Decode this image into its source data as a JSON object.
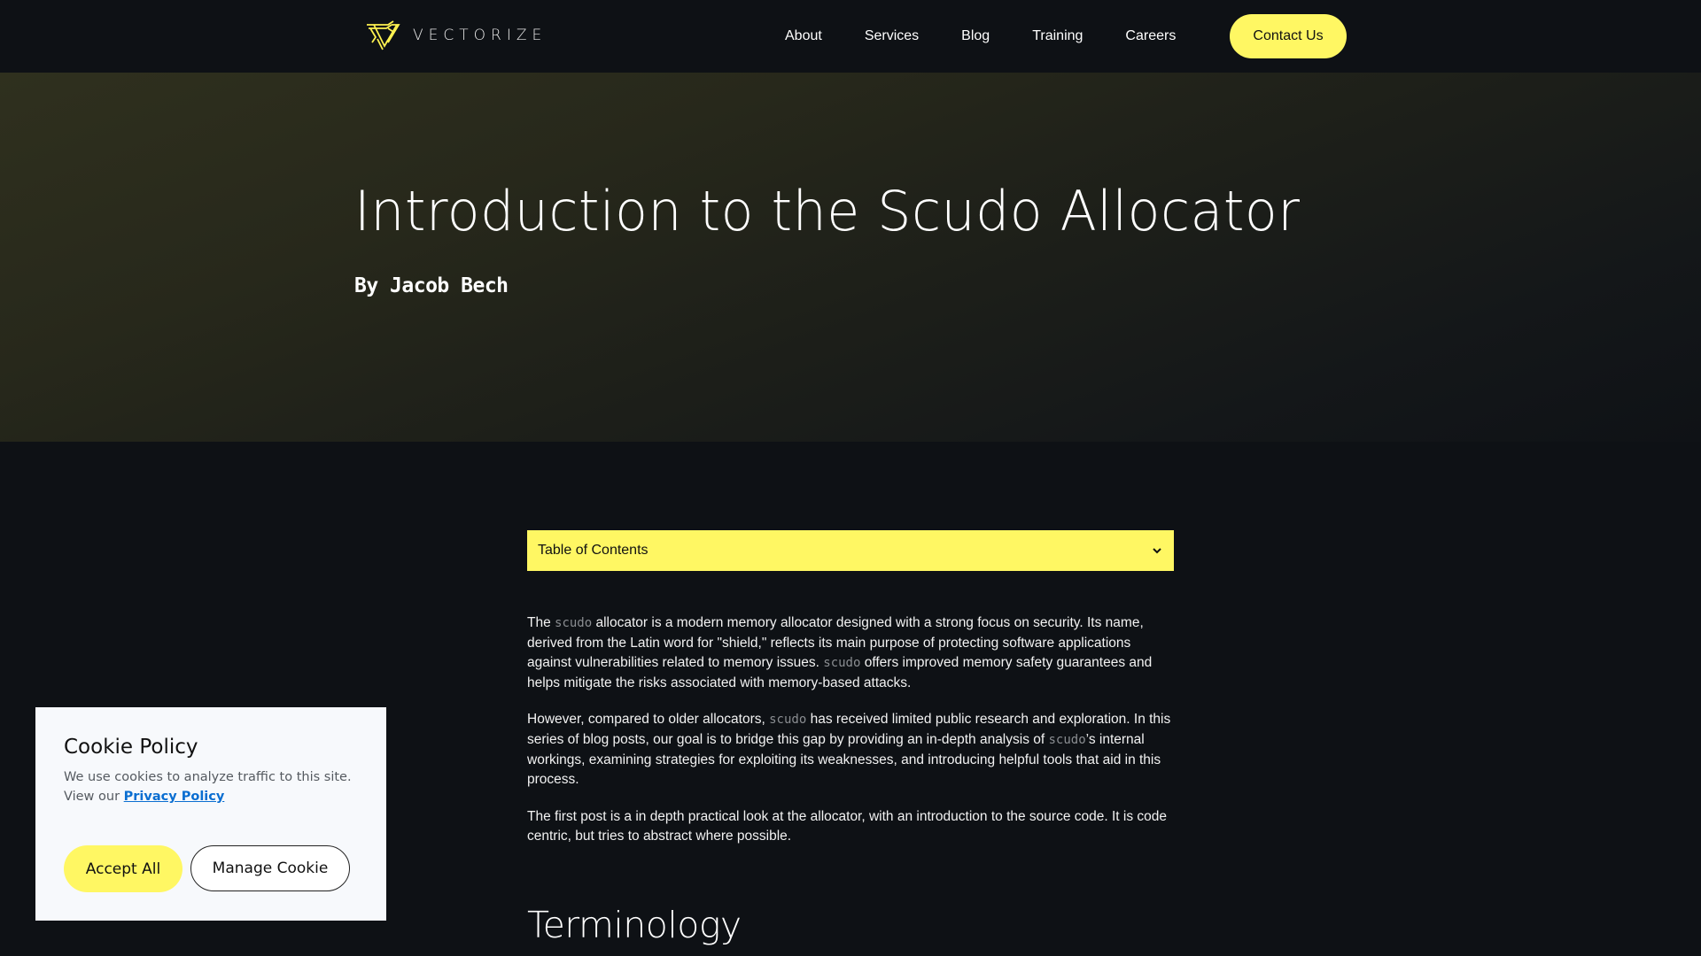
{
  "header": {
    "logo_text": "VECTORIZE",
    "nav": [
      {
        "label": "About"
      },
      {
        "label": "Services"
      },
      {
        "label": "Blog"
      },
      {
        "label": "Training"
      },
      {
        "label": "Careers"
      }
    ],
    "contact_label": "Contact Us"
  },
  "hero": {
    "title": "Introduction to the Scudo Allocator",
    "author": "By Jacob Bech"
  },
  "toc": {
    "label": "Table of Contents",
    "icon": "chevron-down-icon"
  },
  "article": {
    "p1": {
      "t1": "The ",
      "code1": "scudo",
      "t2": " allocator is a modern memory allocator designed with a strong focus on security. Its name, derived from the Latin word for \"shield,\" reflects its main purpose of protecting software applications against vulnerabilities related to memory issues. ",
      "code2": "scudo",
      "t3": " offers improved memory safety guarantees and helps mitigate the risks associated with memory-based attacks."
    },
    "p2": {
      "t1": "However, compared to older allocators, ",
      "code1": "scudo",
      "t2": " has received limited public research and exploration. In this series of blog posts, our goal is to bridge this gap by providing an in-depth analysis of ",
      "code2": "scudo",
      "t3": "’s internal workings, examining strategies for exploiting its weaknesses, and introducing helpful tools that aid in this process."
    },
    "p3": "The first post is a in depth practical look at the allocator, with an introduction to the source code. It is code centric, but tries to abstract where possible.",
    "heading": "Terminology"
  },
  "cookie": {
    "title": "Cookie Policy",
    "text": "We use cookies to analyze traffic to this site. View our ",
    "link": "Privacy Policy",
    "accept_label": "Accept All",
    "manage_label": "Manage Cookie"
  },
  "colors": {
    "accent": "#fff763",
    "background": "#0e1115",
    "link": "#0a6ed1"
  }
}
